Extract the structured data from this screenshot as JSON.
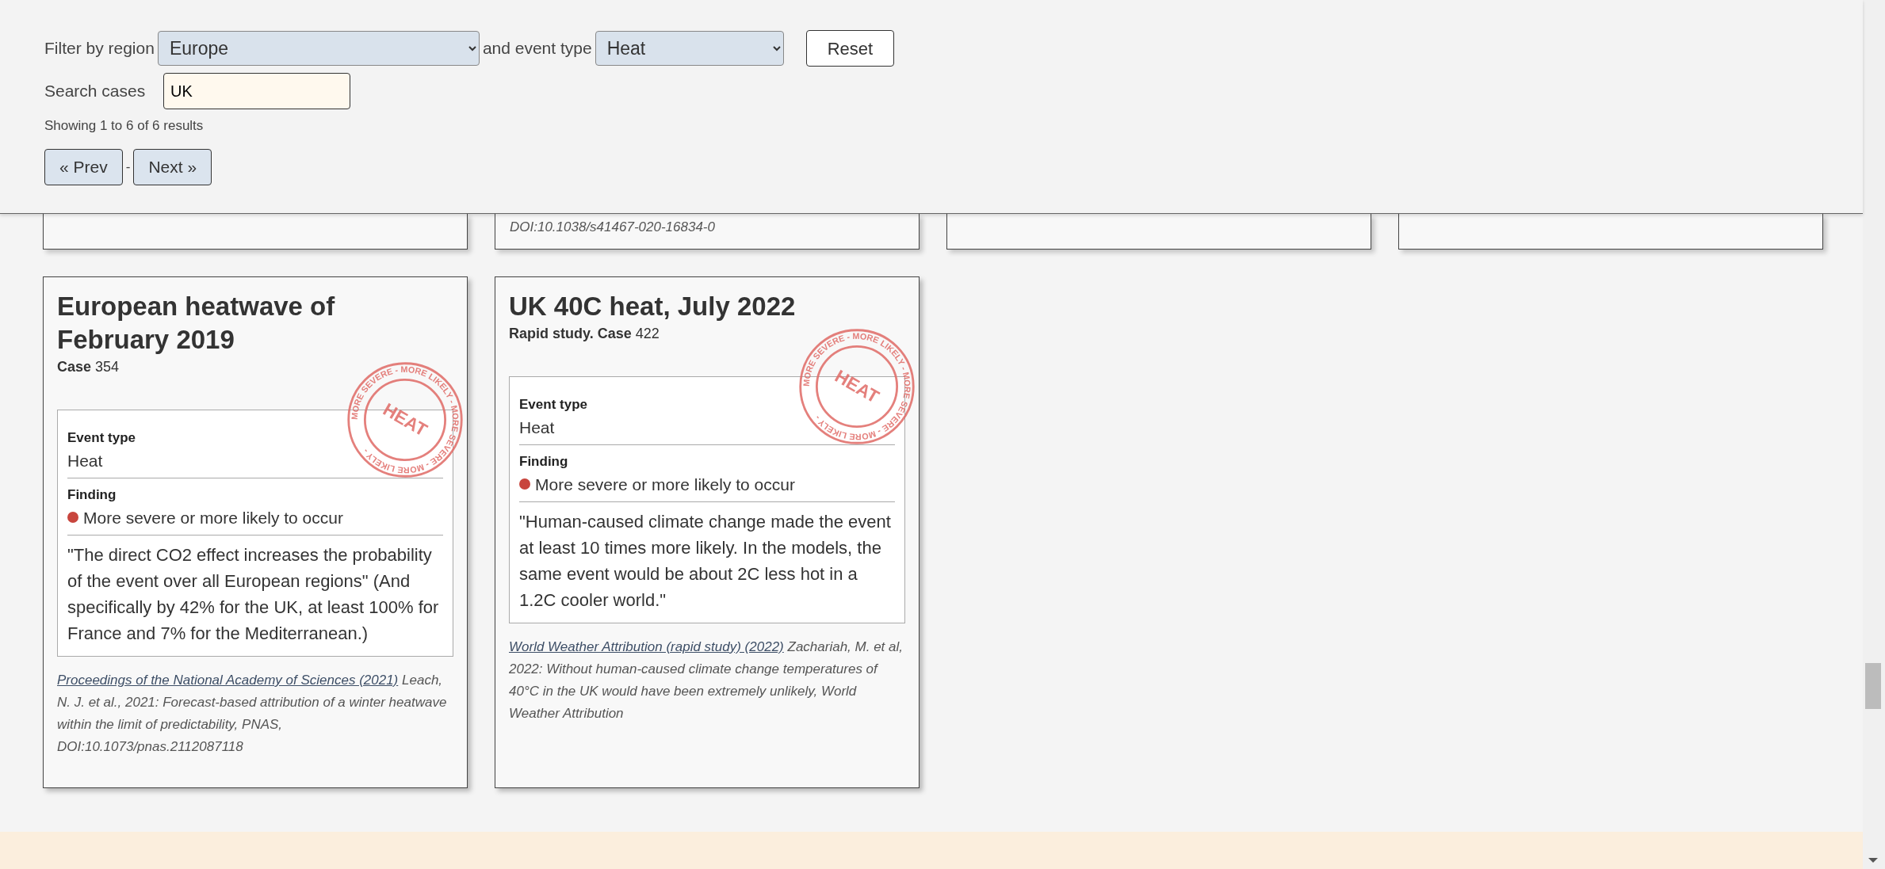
{
  "filters": {
    "region_label": "Filter by region",
    "region": "Europe",
    "type_label": "and event type",
    "event_type": "Heat",
    "reset": "Reset",
    "search_label": "Search cases",
    "search": "UK",
    "results": "Showing 1 to 6 of 6 results",
    "prev": "« Prev",
    "separator": "-",
    "next": "Next »"
  },
  "partial_cards": [
    {
      "kind": "empty"
    },
    {
      "kind": "text",
      "text": "DOI:10.1038/s41467-020-16834-0"
    },
    {
      "kind": "empty"
    },
    {
      "kind": "empty"
    }
  ],
  "cards": [
    {
      "title": "European heatwave of February 2019",
      "subtitle": "Case",
      "case_number": "354",
      "stamp": {
        "ring_text": "MORE SEVERE - MORE LIKELY - MORE SEVERE - MORE LIKELY -",
        "label": "HEAT"
      },
      "event_type_label": "Event type",
      "event_type": "Heat",
      "finding_label": "Finding",
      "finding": "More severe or more likely to occur",
      "color": "#c8453d",
      "quote": "\"The direct CO2 effect increases the probability of the event over all European regions\" (And specifically by 42% for the UK, at least 100% for France and 7% for the Mediterranean.)",
      "source_link": "Proceedings of the National Academy of Sciences (2021)",
      "source_text": "Leach, N. J. et al., 2021: Forecast-based attribution of a winter heatwave within the limit of predictability, PNAS, DOI:10.1073/pnas.2112087118"
    },
    {
      "title": "UK 40C heat, July 2022",
      "subtitle": "Rapid study. Case",
      "case_number": "422",
      "stamp": {
        "ring_text": "MORE SEVERE - MORE LIKELY - MORE SEVERE - MORE LIKELY -",
        "label": "HEAT"
      },
      "event_type_label": "Event type",
      "event_type": "Heat",
      "finding_label": "Finding",
      "finding": "More severe or more likely to occur",
      "color": "#c8453d",
      "quote": "\"Human-caused climate change made the event at least 10 times more likely. In the models, the same event would be about 2C less hot in a 1.2C cooler world.\"",
      "source_link": "World Weather Attribution (rapid study) (2022)",
      "source_text": "Zachariah, M. et al, 2022: Without human-caused climate change temperatures of 40°C in the UK would have been extremely unlikely, World Weather Attribution"
    }
  ]
}
